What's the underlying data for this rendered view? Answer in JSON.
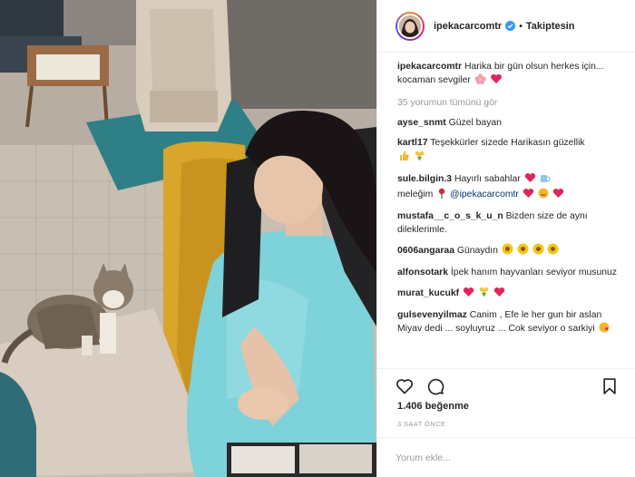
{
  "post": {
    "username": "ipekacarcomtr",
    "follow_state": "Takiptesin",
    "dot": "•",
    "caption_text": "Harika bir gün olsun herkes için... kocaman sevgiler",
    "view_all": "35 yorumun tümünü gör",
    "likes": "1.406 beğenme",
    "timestamp": "3 SAAT ÖNCE",
    "comment_placeholder": "Yorum ekle..."
  },
  "comments": [
    {
      "user": "ayse_snmt",
      "text": "Güzel bayan"
    },
    {
      "user": "kartl17",
      "text": "Teşekkürler sizede Harikasın güzellik"
    },
    {
      "user": "sule.bilgin.3",
      "text": "Hayırlı sabahlar",
      "text2": "meleğim",
      "mention": "@ipekacarcomtr"
    },
    {
      "user": "mustafa__c_o_s_k_u_n",
      "text": "Bizden size de aynı dileklerimle."
    },
    {
      "user": "0606angaraa",
      "text": "Günaydın"
    },
    {
      "user": "alfonsotark",
      "text": "İpek hanım hayvanları seviyor musunuz"
    },
    {
      "user": "murat_kucukf",
      "text": ""
    },
    {
      "user": "gulsevenyilmaz",
      "text": "Canim , Efe le her gun bir aslan Miyav dedi ... soyluyruz ... Cok seviyor o sarkiyi"
    }
  ],
  "icons": {
    "verified": "verified-badge-icon",
    "like": "heart-icon",
    "comment": "comment-bubble-icon",
    "save": "bookmark-icon"
  },
  "colors": {
    "link": "#003569",
    "muted": "#999999",
    "verified": "#3897f0",
    "heart": "#e0245e"
  }
}
